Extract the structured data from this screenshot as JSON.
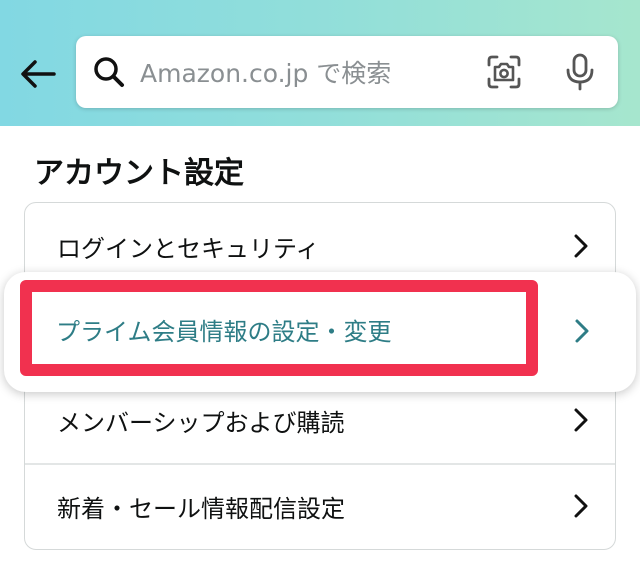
{
  "header": {
    "search": {
      "placeholder": "Amazon.co.jp で検索",
      "value": ""
    },
    "icons": {
      "back": "arrow-left-icon",
      "search": "search-icon",
      "camera": "camera-scan-icon",
      "voice": "microphone-icon"
    }
  },
  "section": {
    "title": "アカウント設定"
  },
  "settings": {
    "items": [
      {
        "label": "ログインとセキュリティ"
      },
      {
        "label": "プライム会員情報の設定・変更",
        "highlighted": true
      },
      {
        "label": "メンバーシップおよび購読"
      },
      {
        "label": "新着・セール情報配信設定"
      }
    ]
  },
  "colors": {
    "header_gradient_start": "#82d8e3",
    "header_gradient_end": "#a6e6ce",
    "highlight_box": "#f1314f",
    "highlight_text": "#2e7d86"
  }
}
